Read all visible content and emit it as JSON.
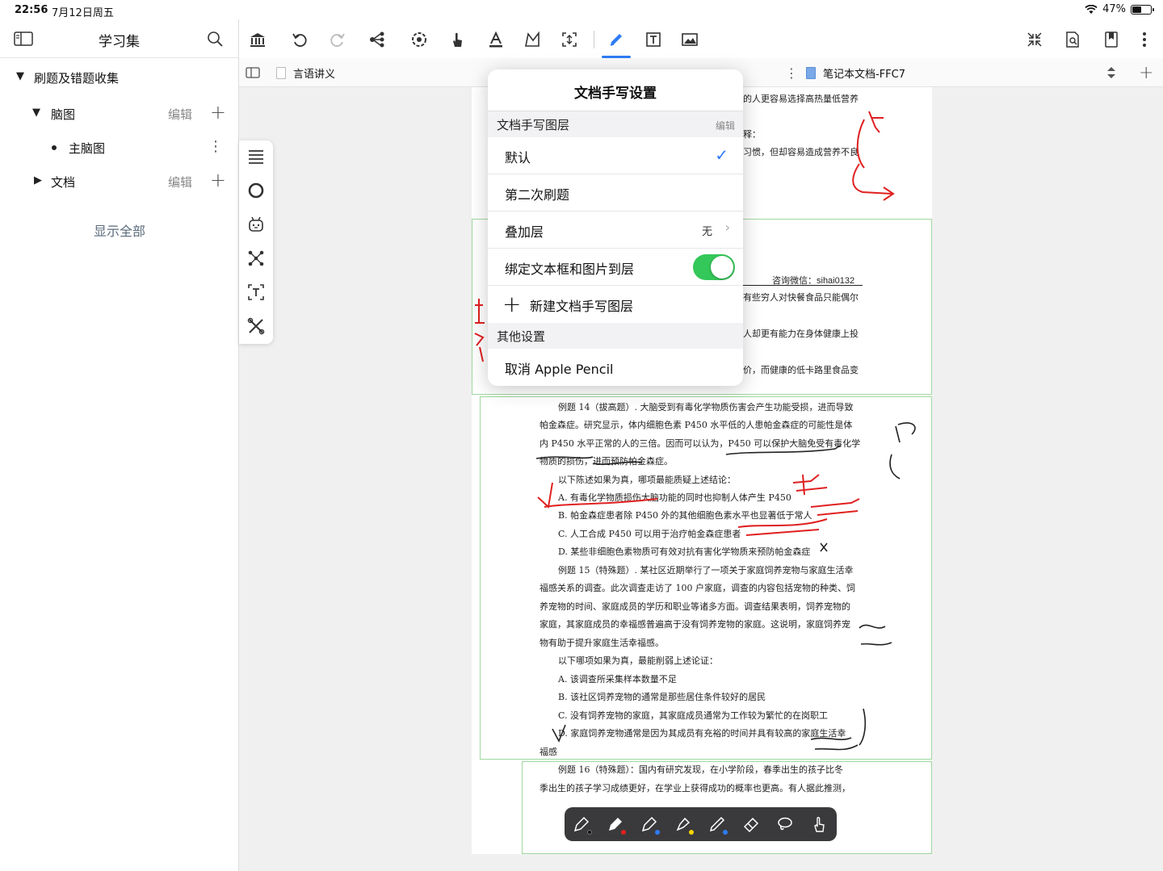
{
  "status": {
    "time": "22:56",
    "date": "7月12日周五",
    "battery": "47%"
  },
  "sidebar": {
    "title": "学习集",
    "root": {
      "label": "刷题及错题收集"
    },
    "items": [
      {
        "label": "脑图",
        "edit": "编辑"
      },
      {
        "label": "主脑图"
      },
      {
        "label": "文档",
        "edit": "编辑"
      }
    ],
    "show_all": "显示全部"
  },
  "tabs": [
    {
      "label": "言语讲义"
    },
    {
      "label": "笔记本文档-FFC7"
    }
  ],
  "popover": {
    "title": "文档手写设置",
    "layer_section": "文档手写图层",
    "layer_edit": "编辑",
    "rows": {
      "default": "默认",
      "second": "第二次刷题",
      "overlay": "叠加层",
      "overlay_value": "无",
      "bind": "绑定文本框和图片到层",
      "new_layer": "新建文档手写图层"
    },
    "other_section": "其他设置",
    "cancel_pencil": "取消 Apple Pencil"
  },
  "page": {
    "lines": [
      "的人更容易选择高热量低营养",
      "释：",
      "习惯，但却容易造成营养不良",
      "咨询微信：sihai0132",
      "有些穷人对快餐食品只能偶尔",
      "人却更有能力在身体健康上投",
      "价，而健康的低卡路里食品变",
      "例题 14（拔高题）. 大脑受到有毒化学物质伤害会产生功能受损，进而导致",
      "帕金森症。研究显示，体内细胞色素 P450 水平低的人患帕金森症的可能性是体",
      "内 P450 水平正常的人的三倍。因而可以认为，P450 可以保护大脑免受有毒化学",
      "物质的损伤，进而预防帕金森症。",
      "以下陈述如果为真，哪项最能质疑上述结论：",
      "A. 有毒化学物质损伤大脑功能的同时也抑制人体产生 P450",
      "B. 帕金森症患者除 P450 外的其他细胞色素水平也显著低于常人",
      "C. 人工合成 P450 可以用于治疗帕金森症患者",
      "D. 某些非细胞色素物质可有效对抗有害化学物质来预防帕金森症",
      "例题 15（特殊题）. 某社区近期举行了一项关于家庭饲养宠物与家庭生活幸",
      "福感关系的调查。此次调查走访了 100 户家庭，调查的内容包括宠物的种类、饲",
      "养宠物的时间、家庭成员的学历和职业等诸多方面。调查结果表明，饲养宠物的",
      "家庭，其家庭成员的幸福感普遍高于没有饲养宠物的家庭。这说明，家庭饲养宠",
      "物有助于提升家庭生活幸福感。",
      "以下哪项如果为真，最能削弱上述论证：",
      "A. 该调查所采集样本数量不足",
      "B. 该社区饲养宠物的通常是那些居住条件较好的居民",
      "C. 没有饲养宠物的家庭，其家庭成员通常为工作较为繁忙的在岗职工",
      "D. 家庭饲养宠物通常是因为其成员有充裕的时间并具有较高的家庭生活幸",
      "福感",
      "例题 16（特殊题）：国内有研究发现，在小学阶段，春季出生的孩子比冬",
      "季出生的孩子学习成绩更好，在学业上获得成功的概率也更高。有人据此推测，"
    ]
  },
  "colors": {
    "accent": "#2f7bf6",
    "toggle_on": "#34c759",
    "ink_red": "#e02020",
    "penbar": "#3a3a3c"
  }
}
